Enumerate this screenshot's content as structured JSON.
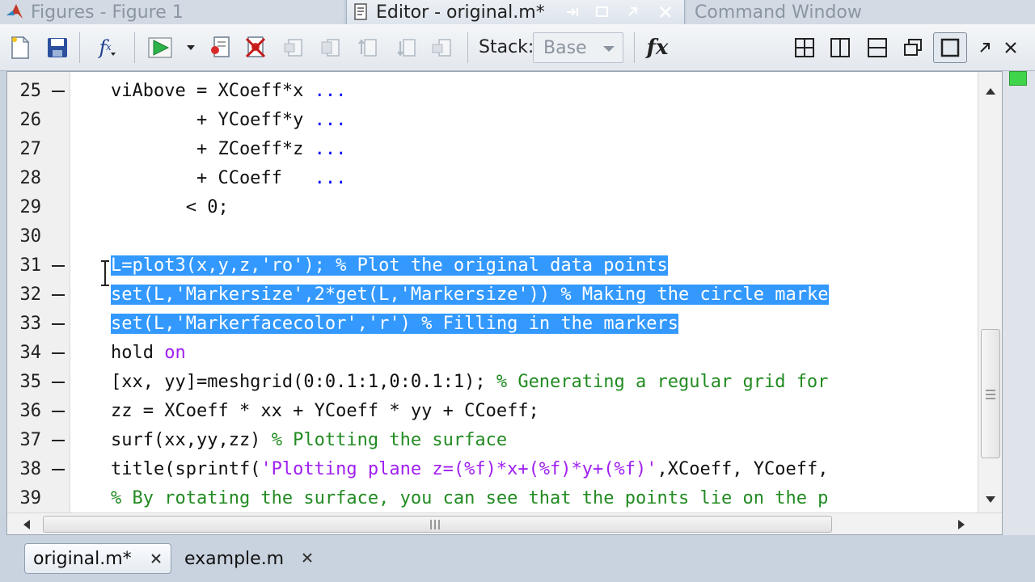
{
  "window_tabs": {
    "figures": "Figures - Figure 1",
    "editor": "Editor - original.m*",
    "command": "Command Window"
  },
  "toolbar": {
    "fx_small": "f",
    "stack_label": "Stack:",
    "stack_value": "Base",
    "fx_big": "fx"
  },
  "editor": {
    "lines": [
      {
        "num": "25",
        "bp": true,
        "segs": [
          {
            "t": "viAbove = XCoeff*x ",
            "c": ""
          },
          {
            "t": "...",
            "c": "kw"
          }
        ]
      },
      {
        "num": "26",
        "bp": false,
        "segs": [
          {
            "t": "        + YCoeff*y ",
            "c": ""
          },
          {
            "t": "...",
            "c": "kw"
          }
        ]
      },
      {
        "num": "27",
        "bp": false,
        "segs": [
          {
            "t": "        + ZCoeff*z ",
            "c": ""
          },
          {
            "t": "...",
            "c": "kw"
          }
        ]
      },
      {
        "num": "28",
        "bp": false,
        "segs": [
          {
            "t": "        + CCoeff   ",
            "c": ""
          },
          {
            "t": "...",
            "c": "kw"
          }
        ]
      },
      {
        "num": "29",
        "bp": false,
        "segs": [
          {
            "t": "       < 0;",
            "c": ""
          }
        ]
      },
      {
        "num": "30",
        "bp": false,
        "segs": []
      },
      {
        "num": "31",
        "bp": true,
        "sel": true,
        "segs": [
          {
            "t": "L=plot3(x,y,z,",
            "c": ""
          },
          {
            "t": "'ro'",
            "c": "str"
          },
          {
            "t": "); ",
            "c": ""
          },
          {
            "t": "% Plot the original data points",
            "c": "com"
          }
        ]
      },
      {
        "num": "32",
        "bp": true,
        "sel": true,
        "segs": [
          {
            "t": "set(L,",
            "c": ""
          },
          {
            "t": "'Markersize'",
            "c": "str"
          },
          {
            "t": ",2*get(L,",
            "c": ""
          },
          {
            "t": "'Markersize'",
            "c": "str"
          },
          {
            "t": ")) ",
            "c": ""
          },
          {
            "t": "% Making the circle marke",
            "c": "com"
          }
        ]
      },
      {
        "num": "33",
        "bp": true,
        "sel": true,
        "segs": [
          {
            "t": "set(L,",
            "c": ""
          },
          {
            "t": "'Markerfacecolor'",
            "c": "str"
          },
          {
            "t": ",",
            "c": ""
          },
          {
            "t": "'r'",
            "c": "str"
          },
          {
            "t": ") ",
            "c": ""
          },
          {
            "t": "% Filling in the markers",
            "c": "com"
          }
        ]
      },
      {
        "num": "34",
        "bp": true,
        "segs": [
          {
            "t": "hold ",
            "c": ""
          },
          {
            "t": "on",
            "c": "str"
          }
        ]
      },
      {
        "num": "35",
        "bp": true,
        "segs": [
          {
            "t": "[xx, yy]=meshgrid(0:0.1:1,0:0.1:1); ",
            "c": ""
          },
          {
            "t": "% Generating a regular grid for",
            "c": "com"
          }
        ]
      },
      {
        "num": "36",
        "bp": true,
        "segs": [
          {
            "t": "zz = XCoeff * xx + YCoeff * yy + CCoeff;",
            "c": ""
          }
        ]
      },
      {
        "num": "37",
        "bp": true,
        "segs": [
          {
            "t": "surf(xx,yy,zz) ",
            "c": ""
          },
          {
            "t": "% Plotting the surface",
            "c": "com"
          }
        ]
      },
      {
        "num": "38",
        "bp": true,
        "segs": [
          {
            "t": "title(sprintf(",
            "c": ""
          },
          {
            "t": "'Plotting plane z=(%f)*x+(%f)*y+(%f)'",
            "c": "str"
          },
          {
            "t": ",XCoeff, YCoeff,",
            "c": ""
          }
        ]
      },
      {
        "num": "39",
        "bp": false,
        "segs": [
          {
            "t": "% By rotating the surface, you can see that the points lie on the p",
            "c": "com"
          }
        ]
      }
    ]
  },
  "doc_tabs": [
    {
      "label": "original.m*",
      "active": true
    },
    {
      "label": "example.m",
      "active": false
    }
  ],
  "colors": {
    "selection": "#3399ff",
    "keyword": "#0000ff",
    "string": "#a020f0",
    "comment": "#228b22",
    "run_green": "#2db34a"
  }
}
